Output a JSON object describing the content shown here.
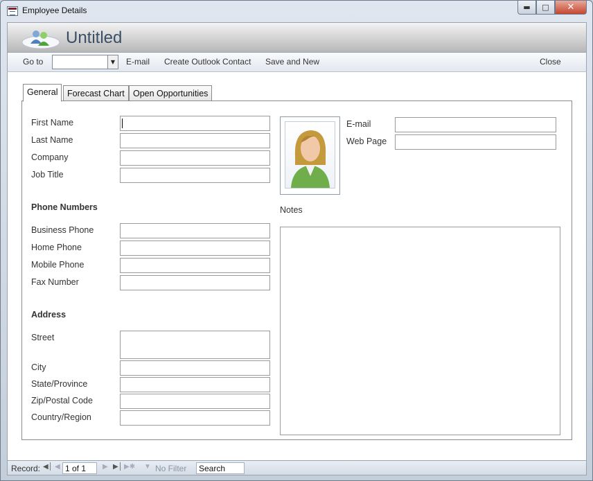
{
  "window": {
    "title": "Employee Details"
  },
  "form": {
    "title": "Untitled"
  },
  "toolbar": {
    "goto_label": "Go to",
    "goto_value": "",
    "email_label": "E-mail",
    "outlook_label": "Create Outlook Contact",
    "save_new_label": "Save and New",
    "close_label": "Close"
  },
  "tabs": [
    {
      "label": "General",
      "active": true
    },
    {
      "label": "Forecast Chart",
      "active": false
    },
    {
      "label": "Open Opportunities",
      "active": false
    }
  ],
  "general": {
    "first_name": {
      "label": "First Name",
      "value": ""
    },
    "last_name": {
      "label": "Last Name",
      "value": ""
    },
    "company": {
      "label": "Company",
      "value": ""
    },
    "job_title": {
      "label": "Job Title",
      "value": ""
    },
    "phone_section": "Phone Numbers",
    "business_phone": {
      "label": "Business Phone",
      "value": ""
    },
    "home_phone": {
      "label": "Home Phone",
      "value": ""
    },
    "mobile_phone": {
      "label": "Mobile Phone",
      "value": ""
    },
    "fax_number": {
      "label": "Fax Number",
      "value": ""
    },
    "address_section": "Address",
    "street": {
      "label": "Street",
      "value": ""
    },
    "city": {
      "label": "City",
      "value": ""
    },
    "state": {
      "label": "State/Province",
      "value": ""
    },
    "zip": {
      "label": "Zip/Postal Code",
      "value": ""
    },
    "country": {
      "label": "Country/Region",
      "value": ""
    },
    "email": {
      "label": "E-mail",
      "value": ""
    },
    "web_page": {
      "label": "Web Page",
      "value": ""
    },
    "notes": {
      "label": "Notes",
      "value": ""
    }
  },
  "statusbar": {
    "record_label": "Record:",
    "record_value": "1 of 1",
    "filter_label": "No Filter",
    "search_placeholder": "Search"
  }
}
